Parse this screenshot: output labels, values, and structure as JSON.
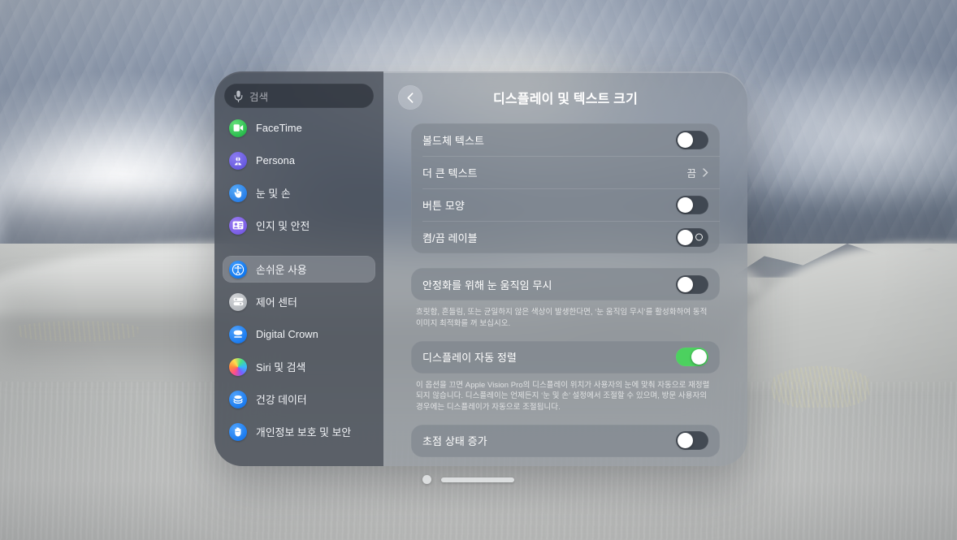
{
  "window": {
    "title": "디스플레이 및 텍스트 크기",
    "back_label": "뒤로"
  },
  "sidebar": {
    "search": {
      "placeholder": "검색",
      "icon": "microphone-icon"
    },
    "items": [
      {
        "label": "FaceTime",
        "icon": "facetime-icon",
        "selected": false
      },
      {
        "label": "Persona",
        "icon": "persona-icon",
        "selected": false
      },
      {
        "label": "눈 및 손",
        "icon": "eye-hand-icon",
        "selected": false
      },
      {
        "label": "인지 및 안전",
        "icon": "awareness-icon",
        "selected": false
      },
      {
        "label": "손쉬운 사용",
        "icon": "accessibility-icon",
        "selected": true
      },
      {
        "label": "제어 센터",
        "icon": "control-center-icon",
        "selected": false
      },
      {
        "label": "Digital Crown",
        "icon": "digital-crown-icon",
        "selected": false
      },
      {
        "label": "Siri 및 검색",
        "icon": "siri-icon",
        "selected": false
      },
      {
        "label": "건강 데이터",
        "icon": "health-icon",
        "selected": false
      },
      {
        "label": "개인정보 보호 및 보안",
        "icon": "privacy-icon",
        "selected": false
      }
    ]
  },
  "main": {
    "group1": {
      "rows": [
        {
          "label": "볼드체 텍스트",
          "type": "toggle",
          "value": "off"
        },
        {
          "label": "더 큰 텍스트",
          "type": "disclosure",
          "value": "끔"
        },
        {
          "label": "버튼 모양",
          "type": "toggle",
          "value": "off"
        },
        {
          "label": "켬/끔 레이블",
          "type": "toggle-labeled",
          "value": "off"
        }
      ]
    },
    "group2": {
      "row": {
        "label": "안정화를 위해 눈 움직임 무시",
        "type": "toggle",
        "value": "off"
      },
      "note": "흐릿함, 흔들림, 또는 균일하지 않은 색상이 발생한다면, ‘눈 움직임 무시’를 활성화하여 동적 이미지 최적화를 꺼 보십시오."
    },
    "group3": {
      "row": {
        "label": "디스플레이 자동 정렬",
        "type": "toggle",
        "value": "on"
      },
      "note": "이 옵션을 끄면 Apple Vision Pro의 디스플레이 위치가 사용자의 눈에 맞춰 자동으로 재정렬되지 않습니다. 디스플레이는 언제든지 ‘눈 및 손’ 설정에서 조절할 수 있으며, 방문 사용자의 경우에는 디스플레이가 자동으로 조절됩니다."
    },
    "group4": {
      "row": {
        "label": "초점 상태 증가",
        "type": "toggle",
        "value": "off"
      }
    }
  },
  "footer": {
    "close_label": "닫기",
    "grab_label": "윈도우 바"
  },
  "colors": {
    "accent_on": "#4cd15f",
    "window_bg": "#80868f",
    "sidebar_bg": "#343942",
    "card_bg": "#7c828b"
  }
}
